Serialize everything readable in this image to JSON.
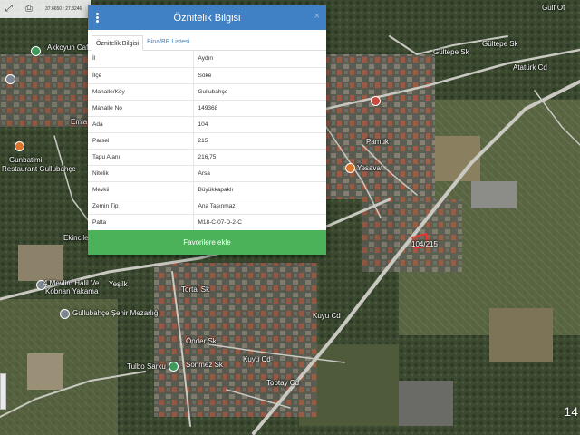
{
  "toolbar": {
    "coords": "37.6650 : 27.3246"
  },
  "modal": {
    "title": "Öznitelik Bilgisi",
    "close_glyph": "×",
    "tabs": [
      {
        "label": "Öznitelik Bilgisi",
        "active": true
      },
      {
        "label": "Bina/BB Listesi",
        "active": false
      }
    ],
    "rows": [
      {
        "key": "İl",
        "value": "Aydın"
      },
      {
        "key": "İlçe",
        "value": "Söke"
      },
      {
        "key": "Mahalle/Köy",
        "value": "Gullubahçe"
      },
      {
        "key": "Mahalle No",
        "value": "149368"
      },
      {
        "key": "Ada",
        "value": "104"
      },
      {
        "key": "Parsel",
        "value": "215"
      },
      {
        "key": "Tapu Alanı",
        "value": "216,75"
      },
      {
        "key": "Nitelik",
        "value": "Arsa"
      },
      {
        "key": "Mevkii",
        "value": "Büyükkapaklı"
      },
      {
        "key": "Zemin Tip",
        "value": "Ana Taşınmaz"
      },
      {
        "key": "Pafta",
        "value": "M18-C-07-D-2-C"
      }
    ],
    "fav_label": "Favorilere ekle"
  },
  "map": {
    "labels": {
      "gulfe": "Gulf Ot",
      "akkoyun": "Akkoyun Cafe",
      "gultepe": "Gültepe Sk",
      "gultepe2": "Gültepe Sk",
      "ataturk": "Atatürk Cd",
      "emlak": "Emla",
      "gunbatimi": "Gunbatimi",
      "restaurant": "Restaurant Gullubahçe",
      "pamuk": "Pamuk",
      "yesavat": "Yesavat",
      "ekincele": "Ekincile",
      "ycsilc": "Yeşilk",
      "mevlim": "4 Mevlim Halil Ve",
      "kobnan": "Kobnan Yakama",
      "gullubahce_mez": "Gullubahçe Şehir Mezarlığı",
      "tuba": "Tulbo Sarku",
      "onder": "Önder Sk",
      "sonmez": "Sönmez Sk",
      "kuyu": "Kuyu Cd",
      "toptay": "Toptay Cd",
      "kuyu2": "Kuyu Cd",
      "ada": "104/215",
      "tortal": "Tortal Sk"
    },
    "zoom_readout": "14"
  },
  "colors": {
    "header_blue": "#3f81c4",
    "button_green": "#4bb25a",
    "road": "#c9c9c2"
  }
}
